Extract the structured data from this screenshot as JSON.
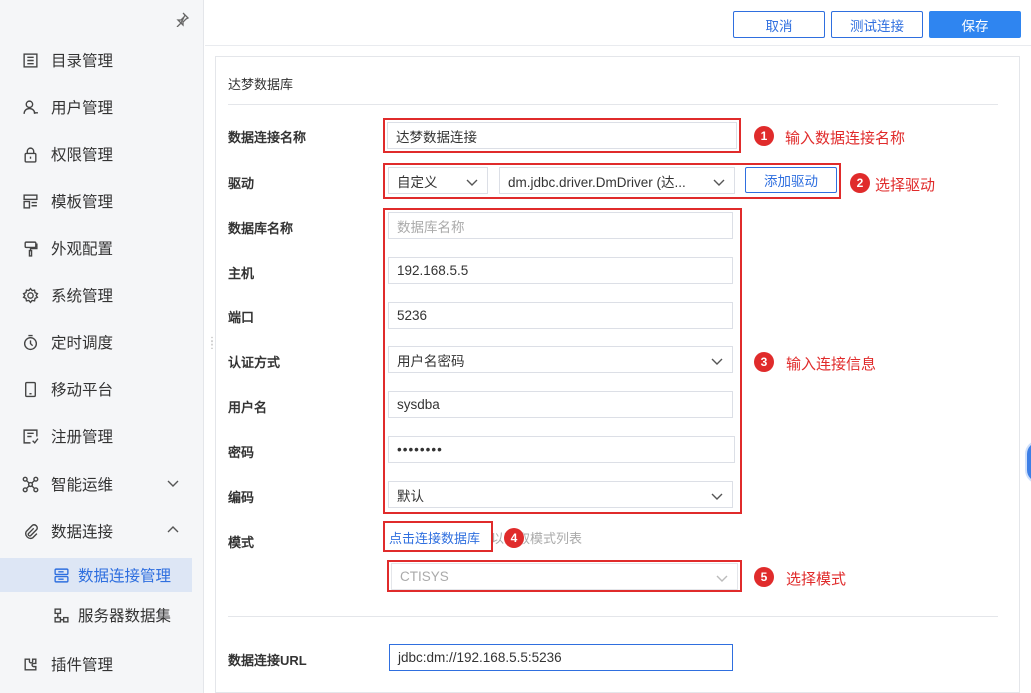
{
  "sidebar": {
    "pin_icon": "pin-icon",
    "items": [
      {
        "label": "目录管理",
        "icon": "list-icon"
      },
      {
        "label": "用户管理",
        "icon": "user-icon"
      },
      {
        "label": "权限管理",
        "icon": "lock-icon"
      },
      {
        "label": "模板管理",
        "icon": "template-icon"
      },
      {
        "label": "外观配置",
        "icon": "brush-icon"
      },
      {
        "label": "系统管理",
        "icon": "gear-icon"
      },
      {
        "label": "定时调度",
        "icon": "timer-icon"
      },
      {
        "label": "移动平台",
        "icon": "mobile-icon"
      },
      {
        "label": "注册管理",
        "icon": "register-icon"
      },
      {
        "label": "智能运维",
        "icon": "nodes-icon"
      },
      {
        "label": "数据连接",
        "icon": "paperclip-icon"
      }
    ],
    "sub_items": [
      {
        "label": "数据连接管理",
        "icon": "database-icon"
      },
      {
        "label": "服务器数据集",
        "icon": "tree-icon"
      }
    ],
    "last_item": {
      "label": "插件管理",
      "icon": "plugin-icon"
    }
  },
  "toolbar": {
    "cancel_label": "取消",
    "test_label": "测试连接",
    "save_label": "保存"
  },
  "form": {
    "section_title": "达梦数据库",
    "conn_name_label": "数据连接名称",
    "conn_name_value": "达梦数据连接",
    "driver_label": "驱动",
    "driver_type": "自定义",
    "driver_class": "dm.jdbc.driver.DmDriver (达...",
    "add_driver_label": "添加驱动",
    "db_name_label": "数据库名称",
    "db_name_placeholder": "数据库名称",
    "host_label": "主机",
    "host_value": "192.168.5.5",
    "port_label": "端口",
    "port_value": "5236",
    "auth_label": "认证方式",
    "auth_value": "用户名密码",
    "user_label": "用户名",
    "user_value": "sysdba",
    "password_label": "密码",
    "password_value": "••••••••",
    "encoding_label": "编码",
    "encoding_value": "默认",
    "schema_label": "模式",
    "schema_link": "点击连接数据库",
    "schema_hint": "以获取模式列表",
    "schema_value": "CTISYS",
    "url_label": "数据连接URL",
    "url_value": "jdbc:dm://192.168.5.5:5236"
  },
  "annotations": [
    {
      "num": "1",
      "text": "输入数据连接名称"
    },
    {
      "num": "2",
      "text": "选择驱动"
    },
    {
      "num": "3",
      "text": "输入连接信息"
    },
    {
      "num": "4",
      "text": ""
    },
    {
      "num": "5",
      "text": "选择模式"
    }
  ],
  "colors": {
    "accent": "#2f6fdf",
    "annotation": "#e02b2b",
    "active_bg": "#dde6f5"
  }
}
